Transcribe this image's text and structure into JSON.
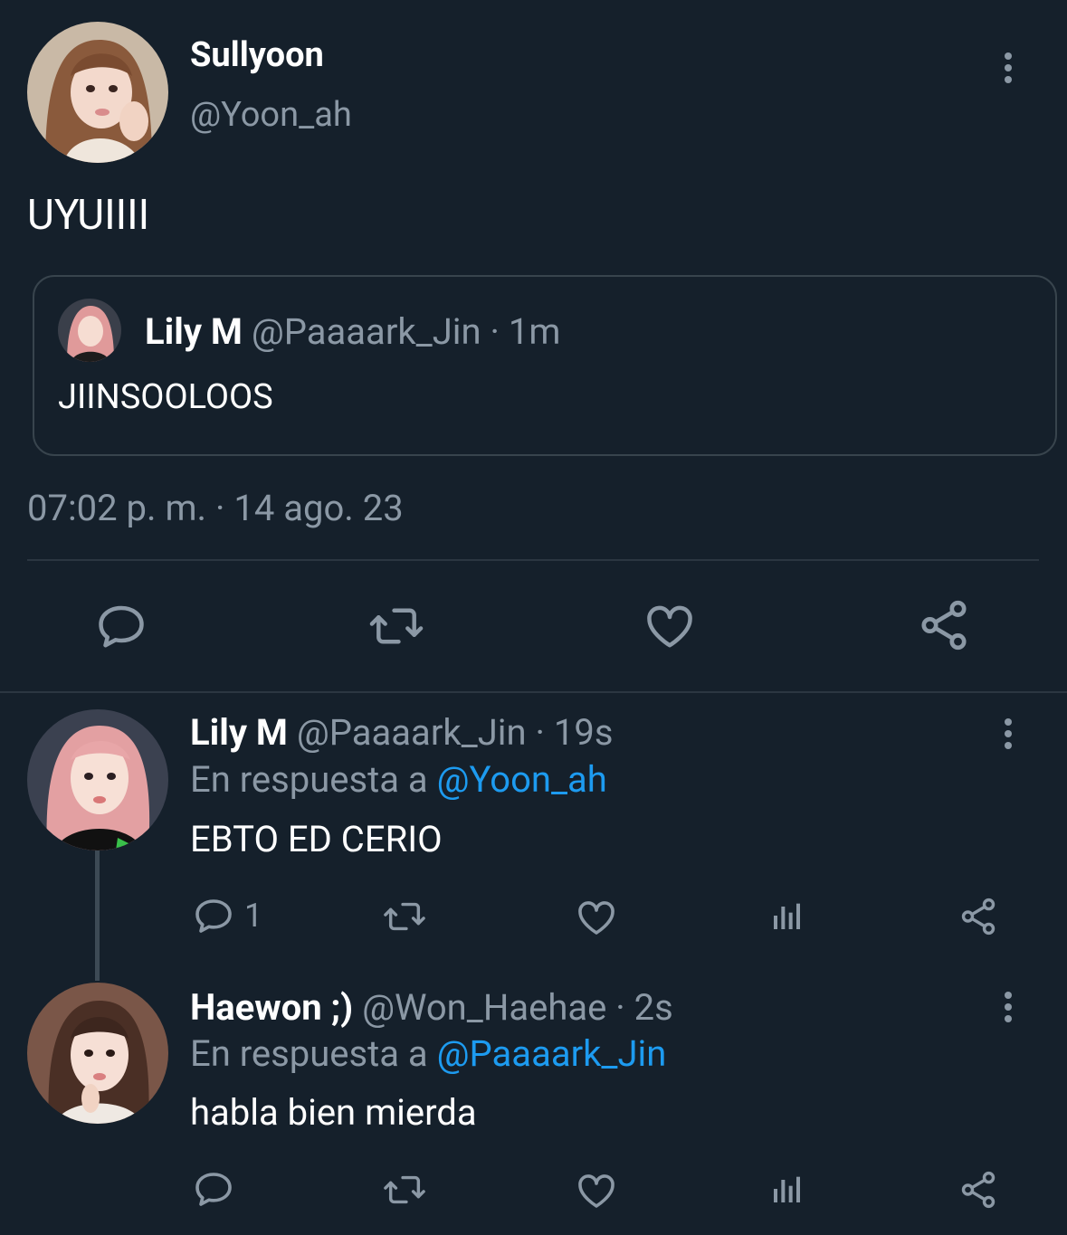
{
  "main_tweet": {
    "display_name": "Sullyoon",
    "handle": "@Yoon_ah",
    "text": "UYUIIII",
    "timestamp": "07:02 p. m. · 14 ago. 23",
    "quoted": {
      "display_name": "Lily M",
      "handle": "@Paaaark_Jin",
      "time": "· 1m",
      "text": "JIINSOOLOOS"
    },
    "actions": [
      "reply-icon",
      "retweet-icon",
      "like-icon",
      "share-icon"
    ]
  },
  "replies": [
    {
      "display_name": "Lily M",
      "handle": "@Paaaark_Jin",
      "time": "· 19s",
      "reply_prefix": "En respuesta a",
      "reply_to": "@Yoon_ah",
      "text": "EBTO ED CERIO",
      "reply_count": "1"
    },
    {
      "display_name": "Haewon ;)",
      "handle": "@Won_Haehae",
      "time": "· 2s",
      "reply_prefix": "En respuesta a",
      "reply_to": "@Paaaark_Jin",
      "text": "habla bien mierda",
      "reply_count": ""
    }
  ],
  "colors": {
    "background": "#15202b",
    "muted": "#8b98a5",
    "link": "#1d9bf0",
    "divider": "#2b3641"
  }
}
